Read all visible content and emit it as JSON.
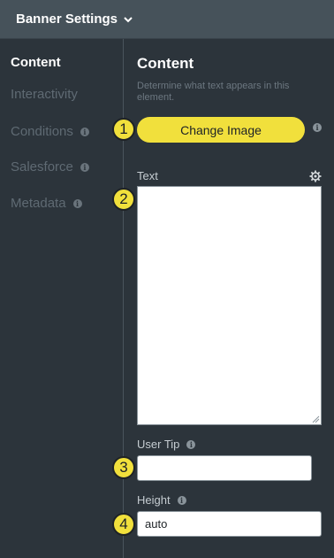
{
  "header": {
    "title": "Banner Settings"
  },
  "sidebar": {
    "items": [
      {
        "label": "Content",
        "active": true,
        "info": false
      },
      {
        "label": "Interactivity",
        "active": false,
        "info": false
      },
      {
        "label": "Conditions",
        "active": false,
        "info": true
      },
      {
        "label": "Salesforce",
        "active": false,
        "info": true
      },
      {
        "label": "Metadata",
        "active": false,
        "info": true
      }
    ]
  },
  "main": {
    "title": "Content",
    "description": "Determine what text appears in this element.",
    "change_image_label": "Change Image",
    "text_label": "Text",
    "text_value": "",
    "user_tip_label": "User Tip",
    "user_tip_value": "",
    "height_label": "Height",
    "height_value": "auto"
  },
  "badges": [
    "1",
    "2",
    "3",
    "4"
  ],
  "colors": {
    "background": "#2c343b",
    "header": "#46525a",
    "accent": "#f1e03c",
    "inactive_text": "#5f6a73"
  },
  "icons": {
    "header_chevron": "chevron-down-icon",
    "info": "info-icon",
    "settings": "gear-icon"
  }
}
